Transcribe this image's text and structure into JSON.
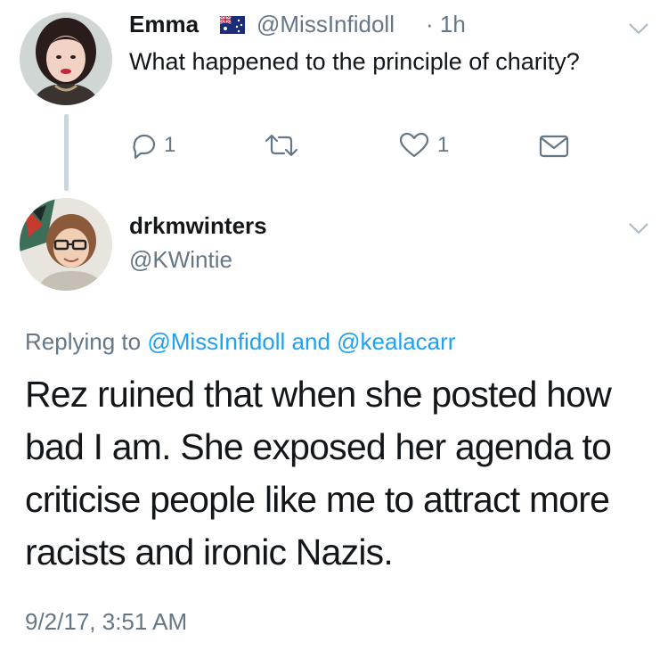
{
  "tweet1": {
    "name": "Emma",
    "flag_icon": "australia-flag-icon",
    "handle": "@MissInfidoll",
    "time": "· 1h",
    "text": "What happened to the principle of charity?",
    "reply_count": "1",
    "like_count": "1"
  },
  "tweet2": {
    "name": "drkmwinters",
    "handle": "@KWintie",
    "replying_prefix": "Replying to ",
    "replying_user1": "@MissInfidoll",
    "replying_and": " and ",
    "replying_user2": "@kealacarr",
    "text": "Rez ruined that when she posted how bad I am. She exposed her agenda to criticise people like me to attract more racists and ironic Nazis.",
    "timestamp": "9/2/17, 3:51 AM"
  },
  "colors": {
    "text": "#14171a",
    "secondary": "#657786",
    "link": "#1da1f2",
    "thread": "#ccd6dd"
  }
}
